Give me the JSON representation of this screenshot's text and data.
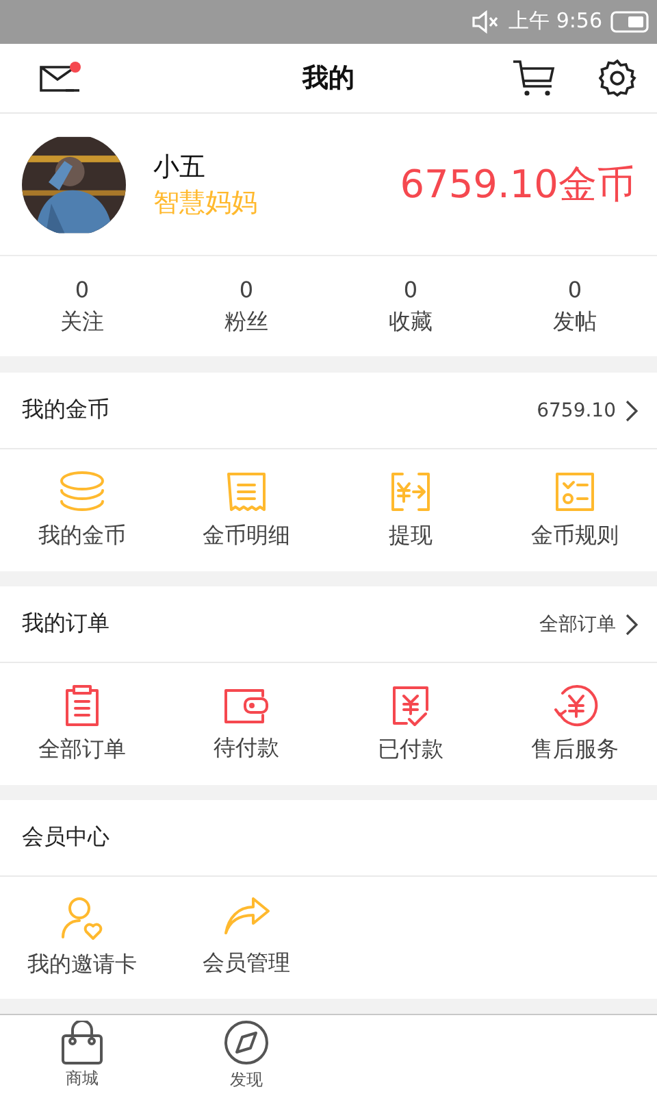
{
  "status_bar": {
    "time": "上午 9:56"
  },
  "header": {
    "title": "我的",
    "unread": true
  },
  "profile": {
    "name": "小五",
    "role": "智慧妈妈",
    "coins": "6759.10金币"
  },
  "stats": [
    {
      "value": "0",
      "label": "关注"
    },
    {
      "value": "0",
      "label": "粉丝"
    },
    {
      "value": "0",
      "label": "收藏"
    },
    {
      "value": "0",
      "label": "发帖"
    }
  ],
  "sections": [
    {
      "title": "我的金币",
      "link": "6759.10",
      "color": "#ffb92e",
      "items": [
        {
          "kind": "coins",
          "label": "我的金币"
        },
        {
          "kind": "receipt",
          "label": "金币明细"
        },
        {
          "kind": "withdraw",
          "label": "提现"
        },
        {
          "kind": "rules",
          "label": "金币规则"
        }
      ]
    },
    {
      "title": "我的订单",
      "link": "全部订单",
      "color": "#f5484f",
      "items": [
        {
          "kind": "clipboard",
          "label": "全部订单"
        },
        {
          "kind": "wallet",
          "label": "待付款"
        },
        {
          "kind": "paid",
          "label": "已付款"
        },
        {
          "kind": "refund",
          "label": "售后服务"
        }
      ]
    },
    {
      "title": "会员中心",
      "color": "#ffb92e",
      "items": [
        {
          "kind": "invite",
          "label": "我的邀请卡"
        },
        {
          "kind": "share",
          "label": "会员管理"
        }
      ]
    }
  ],
  "tab_bar": [
    {
      "kind": "bag",
      "label": "商城"
    },
    {
      "kind": "compass",
      "label": "发现"
    }
  ]
}
